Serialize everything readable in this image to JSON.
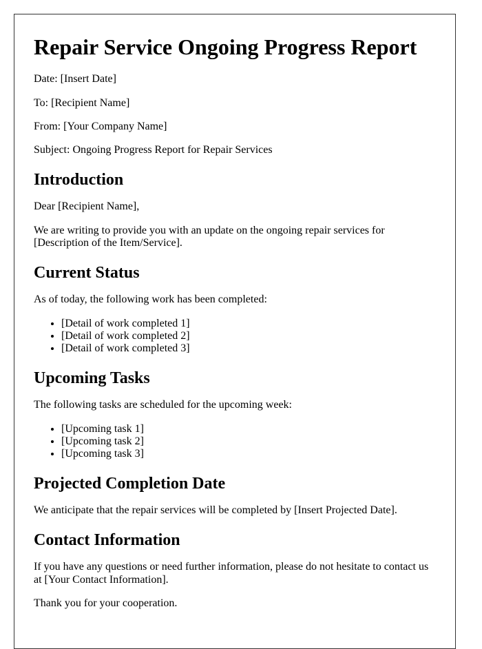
{
  "document": {
    "title": "Repair Service Ongoing Progress Report",
    "header_fields": [
      {
        "label": "Date:",
        "value": "[Insert Date]"
      },
      {
        "label": "To:",
        "value": "[Recipient Name]"
      },
      {
        "label": "From:",
        "value": "[Your Company Name]"
      },
      {
        "label": "Subject:",
        "value": "Ongoing Progress Report for Repair Services"
      }
    ],
    "sections": {
      "introduction": {
        "heading": "Introduction",
        "salutation": "Dear [Recipient Name],",
        "body": "We are writing to provide you with an update on the ongoing repair services for [Description of the Item/Service]."
      },
      "current_status": {
        "heading": "Current Status",
        "intro": "As of today, the following work has been completed:",
        "items": [
          "[Detail of work completed 1]",
          "[Detail of work completed 2]",
          "[Detail of work completed 3]"
        ]
      },
      "upcoming_tasks": {
        "heading": "Upcoming Tasks",
        "intro": "The following tasks are scheduled for the upcoming week:",
        "items": [
          "[Upcoming task 1]",
          "[Upcoming task 2]",
          "[Upcoming task 3]"
        ]
      },
      "projected_completion": {
        "heading": "Projected Completion Date",
        "body": "We anticipate that the repair services will be completed by [Insert Projected Date]."
      },
      "contact_information": {
        "heading": "Contact Information",
        "body": "If you have any questions or need further information, please do not hesitate to contact us at [Your Contact Information].",
        "closing": "Thank you for your cooperation."
      }
    }
  }
}
